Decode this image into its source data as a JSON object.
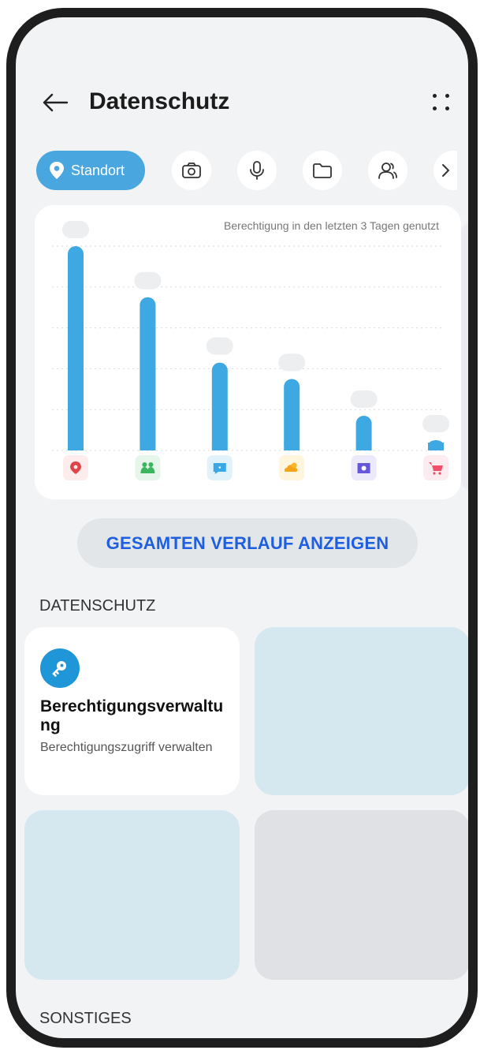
{
  "header": {
    "title": "Datenschutz"
  },
  "chips": {
    "active_label": "Standort",
    "items": [
      "camera-icon",
      "microphone-icon",
      "folder-icon",
      "contacts-icon"
    ]
  },
  "chart_data": {
    "type": "bar",
    "subtitle": "Berechtigung in den letzten 3 Tagen genutzt",
    "categories": [
      "maps-app",
      "community-app",
      "messages-app",
      "weather-app",
      "video-app",
      "shopping-app"
    ],
    "icons": [
      {
        "name": "map-pin-app-icon",
        "bg": "#fdecec",
        "fg": "#e0454a"
      },
      {
        "name": "people-app-icon",
        "bg": "#e6f6ea",
        "fg": "#3cb55f"
      },
      {
        "name": "chat-app-icon",
        "bg": "#e2f2fb",
        "fg": "#3aa7e6"
      },
      {
        "name": "weather-app-icon",
        "bg": "#fff4dc",
        "fg": "#f3a417"
      },
      {
        "name": "video-app-icon",
        "bg": "#ece9fb",
        "fg": "#6656d9"
      },
      {
        "name": "cart-app-icon",
        "bg": "#fdecef",
        "fg": "#f05069"
      }
    ],
    "values": [
      100,
      75,
      43,
      35,
      17,
      5
    ],
    "ylim": [
      0,
      100
    ],
    "bar_color": "#3ea8e2",
    "grid": true
  },
  "history_button": {
    "label": "GESAMTEN VERLAUF ANZEIGEN"
  },
  "sections": {
    "privacy_label": "DATENSCHUTZ",
    "other_label": "SONSTIGES"
  },
  "tiles": {
    "permission_title": "Berechtigungsverwaltung",
    "permission_subtitle": "Berechtigungszugriff verwalten",
    "placeholder_colors": [
      "#d5e8f0",
      "#d5e8f0",
      "#dfe1e4"
    ]
  },
  "colors": {
    "accent": "#4aa6de",
    "link": "#1d5fe0"
  }
}
